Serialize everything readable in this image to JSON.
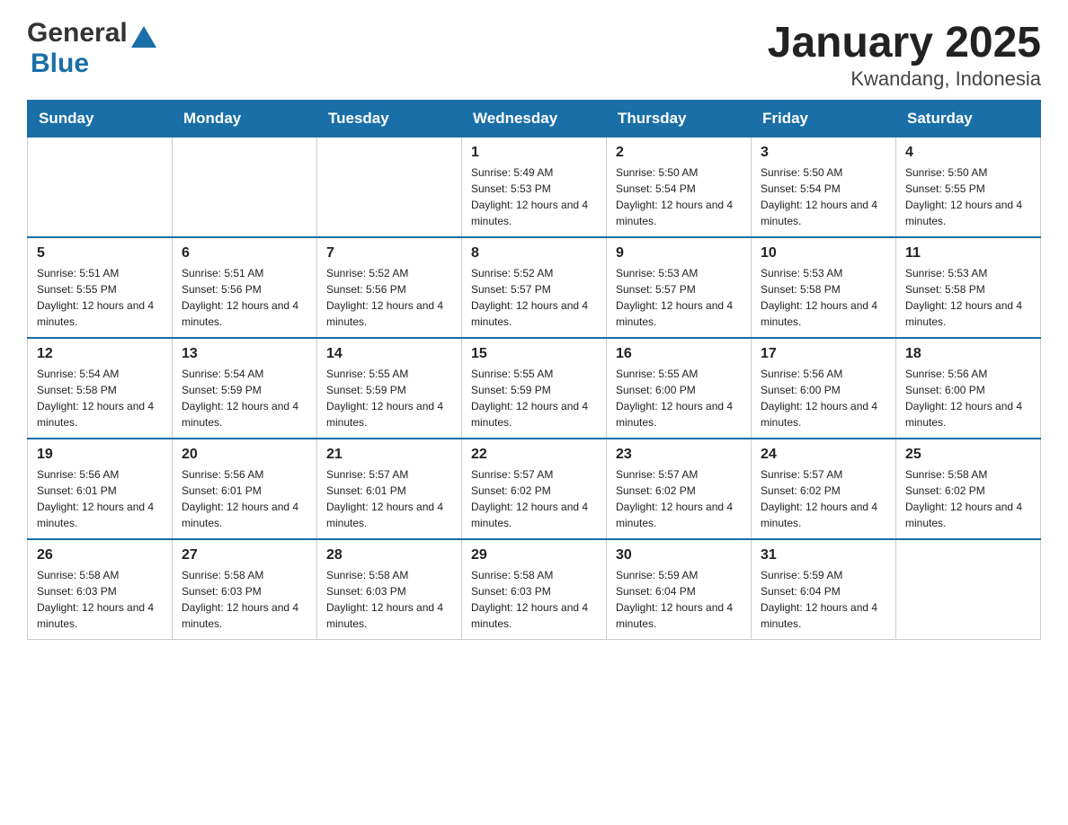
{
  "header": {
    "logo_general": "General",
    "logo_blue": "Blue",
    "title": "January 2025",
    "subtitle": "Kwandang, Indonesia"
  },
  "days_of_week": [
    "Sunday",
    "Monday",
    "Tuesday",
    "Wednesday",
    "Thursday",
    "Friday",
    "Saturday"
  ],
  "weeks": [
    [
      {
        "day": "",
        "info": ""
      },
      {
        "day": "",
        "info": ""
      },
      {
        "day": "",
        "info": ""
      },
      {
        "day": "1",
        "info": "Sunrise: 5:49 AM\nSunset: 5:53 PM\nDaylight: 12 hours and 4 minutes."
      },
      {
        "day": "2",
        "info": "Sunrise: 5:50 AM\nSunset: 5:54 PM\nDaylight: 12 hours and 4 minutes."
      },
      {
        "day": "3",
        "info": "Sunrise: 5:50 AM\nSunset: 5:54 PM\nDaylight: 12 hours and 4 minutes."
      },
      {
        "day": "4",
        "info": "Sunrise: 5:50 AM\nSunset: 5:55 PM\nDaylight: 12 hours and 4 minutes."
      }
    ],
    [
      {
        "day": "5",
        "info": "Sunrise: 5:51 AM\nSunset: 5:55 PM\nDaylight: 12 hours and 4 minutes."
      },
      {
        "day": "6",
        "info": "Sunrise: 5:51 AM\nSunset: 5:56 PM\nDaylight: 12 hours and 4 minutes."
      },
      {
        "day": "7",
        "info": "Sunrise: 5:52 AM\nSunset: 5:56 PM\nDaylight: 12 hours and 4 minutes."
      },
      {
        "day": "8",
        "info": "Sunrise: 5:52 AM\nSunset: 5:57 PM\nDaylight: 12 hours and 4 minutes."
      },
      {
        "day": "9",
        "info": "Sunrise: 5:53 AM\nSunset: 5:57 PM\nDaylight: 12 hours and 4 minutes."
      },
      {
        "day": "10",
        "info": "Sunrise: 5:53 AM\nSunset: 5:58 PM\nDaylight: 12 hours and 4 minutes."
      },
      {
        "day": "11",
        "info": "Sunrise: 5:53 AM\nSunset: 5:58 PM\nDaylight: 12 hours and 4 minutes."
      }
    ],
    [
      {
        "day": "12",
        "info": "Sunrise: 5:54 AM\nSunset: 5:58 PM\nDaylight: 12 hours and 4 minutes."
      },
      {
        "day": "13",
        "info": "Sunrise: 5:54 AM\nSunset: 5:59 PM\nDaylight: 12 hours and 4 minutes."
      },
      {
        "day": "14",
        "info": "Sunrise: 5:55 AM\nSunset: 5:59 PM\nDaylight: 12 hours and 4 minutes."
      },
      {
        "day": "15",
        "info": "Sunrise: 5:55 AM\nSunset: 5:59 PM\nDaylight: 12 hours and 4 minutes."
      },
      {
        "day": "16",
        "info": "Sunrise: 5:55 AM\nSunset: 6:00 PM\nDaylight: 12 hours and 4 minutes."
      },
      {
        "day": "17",
        "info": "Sunrise: 5:56 AM\nSunset: 6:00 PM\nDaylight: 12 hours and 4 minutes."
      },
      {
        "day": "18",
        "info": "Sunrise: 5:56 AM\nSunset: 6:00 PM\nDaylight: 12 hours and 4 minutes."
      }
    ],
    [
      {
        "day": "19",
        "info": "Sunrise: 5:56 AM\nSunset: 6:01 PM\nDaylight: 12 hours and 4 minutes."
      },
      {
        "day": "20",
        "info": "Sunrise: 5:56 AM\nSunset: 6:01 PM\nDaylight: 12 hours and 4 minutes."
      },
      {
        "day": "21",
        "info": "Sunrise: 5:57 AM\nSunset: 6:01 PM\nDaylight: 12 hours and 4 minutes."
      },
      {
        "day": "22",
        "info": "Sunrise: 5:57 AM\nSunset: 6:02 PM\nDaylight: 12 hours and 4 minutes."
      },
      {
        "day": "23",
        "info": "Sunrise: 5:57 AM\nSunset: 6:02 PM\nDaylight: 12 hours and 4 minutes."
      },
      {
        "day": "24",
        "info": "Sunrise: 5:57 AM\nSunset: 6:02 PM\nDaylight: 12 hours and 4 minutes."
      },
      {
        "day": "25",
        "info": "Sunrise: 5:58 AM\nSunset: 6:02 PM\nDaylight: 12 hours and 4 minutes."
      }
    ],
    [
      {
        "day": "26",
        "info": "Sunrise: 5:58 AM\nSunset: 6:03 PM\nDaylight: 12 hours and 4 minutes."
      },
      {
        "day": "27",
        "info": "Sunrise: 5:58 AM\nSunset: 6:03 PM\nDaylight: 12 hours and 4 minutes."
      },
      {
        "day": "28",
        "info": "Sunrise: 5:58 AM\nSunset: 6:03 PM\nDaylight: 12 hours and 4 minutes."
      },
      {
        "day": "29",
        "info": "Sunrise: 5:58 AM\nSunset: 6:03 PM\nDaylight: 12 hours and 4 minutes."
      },
      {
        "day": "30",
        "info": "Sunrise: 5:59 AM\nSunset: 6:04 PM\nDaylight: 12 hours and 4 minutes."
      },
      {
        "day": "31",
        "info": "Sunrise: 5:59 AM\nSunset: 6:04 PM\nDaylight: 12 hours and 4 minutes."
      },
      {
        "day": "",
        "info": ""
      }
    ]
  ]
}
